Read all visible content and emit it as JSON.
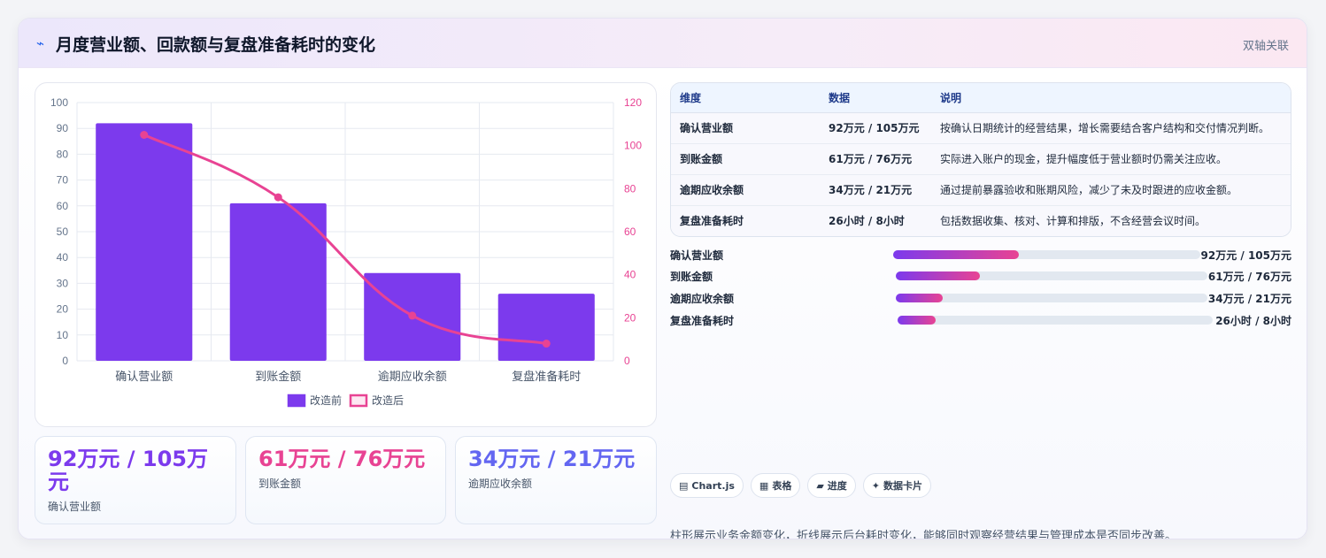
{
  "header": {
    "title": "月度营业额、回款额与复盘准备耗时的变化",
    "tag": "双轴关联",
    "title_icon": "chart-line-icon"
  },
  "colors": {
    "bar": "#7c3aed",
    "line": "#e84393",
    "accent_blue": "#6366f1",
    "axis_text_left": "#64748b",
    "axis_text_right": "#e84393"
  },
  "chart_data": {
    "type": "bar",
    "categories": [
      "确认营业额",
      "到账金额",
      "逾期应收余额",
      "复盘准备耗时"
    ],
    "series": [
      {
        "name": "改造前",
        "type": "bar",
        "axis": "left",
        "values": [
          92,
          61,
          34,
          26
        ]
      },
      {
        "name": "改造后",
        "type": "line",
        "axis": "right",
        "values": [
          105,
          76,
          21,
          8
        ]
      }
    ],
    "y_left": {
      "min": 0,
      "max": 100,
      "ticks": [
        0,
        10,
        20,
        30,
        40,
        50,
        60,
        70,
        80,
        90,
        100
      ]
    },
    "y_right": {
      "min": 0,
      "max": 120,
      "ticks": [
        0,
        20,
        40,
        60,
        80,
        100,
        120
      ]
    },
    "grid": true,
    "legend_position": "bottom"
  },
  "stats": [
    {
      "value": "92万元 / 105万元",
      "label": "确认营业额",
      "color": "#7c3aed"
    },
    {
      "value": "61万元 / 76万元",
      "label": "到账金额",
      "color": "#e84393"
    },
    {
      "value": "34万元 / 21万元",
      "label": "逾期应收余额",
      "color": "#6366f1"
    }
  ],
  "table": {
    "headers": [
      "维度",
      "数据",
      "说明"
    ],
    "rows": [
      [
        "确认营业额",
        "92万元 / 105万元",
        "按确认日期统计的经营结果，增长需要结合客户结构和交付情况判断。"
      ],
      [
        "到账金额",
        "61万元 / 76万元",
        "实际进入账户的现金，提升幅度低于营业额时仍需关注应收。"
      ],
      [
        "逾期应收余额",
        "34万元 / 21万元",
        "通过提前暴露验收和账期风险，减少了未及时跟进的应收金额。"
      ],
      [
        "复盘准备耗时",
        "26小时 / 8小时",
        "包括数据收集、核对、计算和排版，不含经营会议时间。"
      ]
    ]
  },
  "progress": [
    {
      "label": "确认营业额",
      "value": "92万元 / 105万元",
      "ratio": 0.41
    },
    {
      "label": "到账金额",
      "value": "61万元 / 76万元",
      "ratio": 0.27
    },
    {
      "label": "逾期应收余额",
      "value": "34万元 / 21万元",
      "ratio": 0.15
    },
    {
      "label": "复盘准备耗时",
      "value": "26小时 / 8小时",
      "ratio": 0.12
    }
  ],
  "badges": [
    {
      "icon": "▤",
      "label": "Chart.js"
    },
    {
      "icon": "▦",
      "label": "表格"
    },
    {
      "icon": "▰",
      "label": "进度"
    },
    {
      "icon": "✦",
      "label": "数据卡片"
    }
  ],
  "footnote": "柱形展示业务金额变化，折线展示后台耗时变化，能够同时观察经营结果与管理成本是否同步改善。"
}
